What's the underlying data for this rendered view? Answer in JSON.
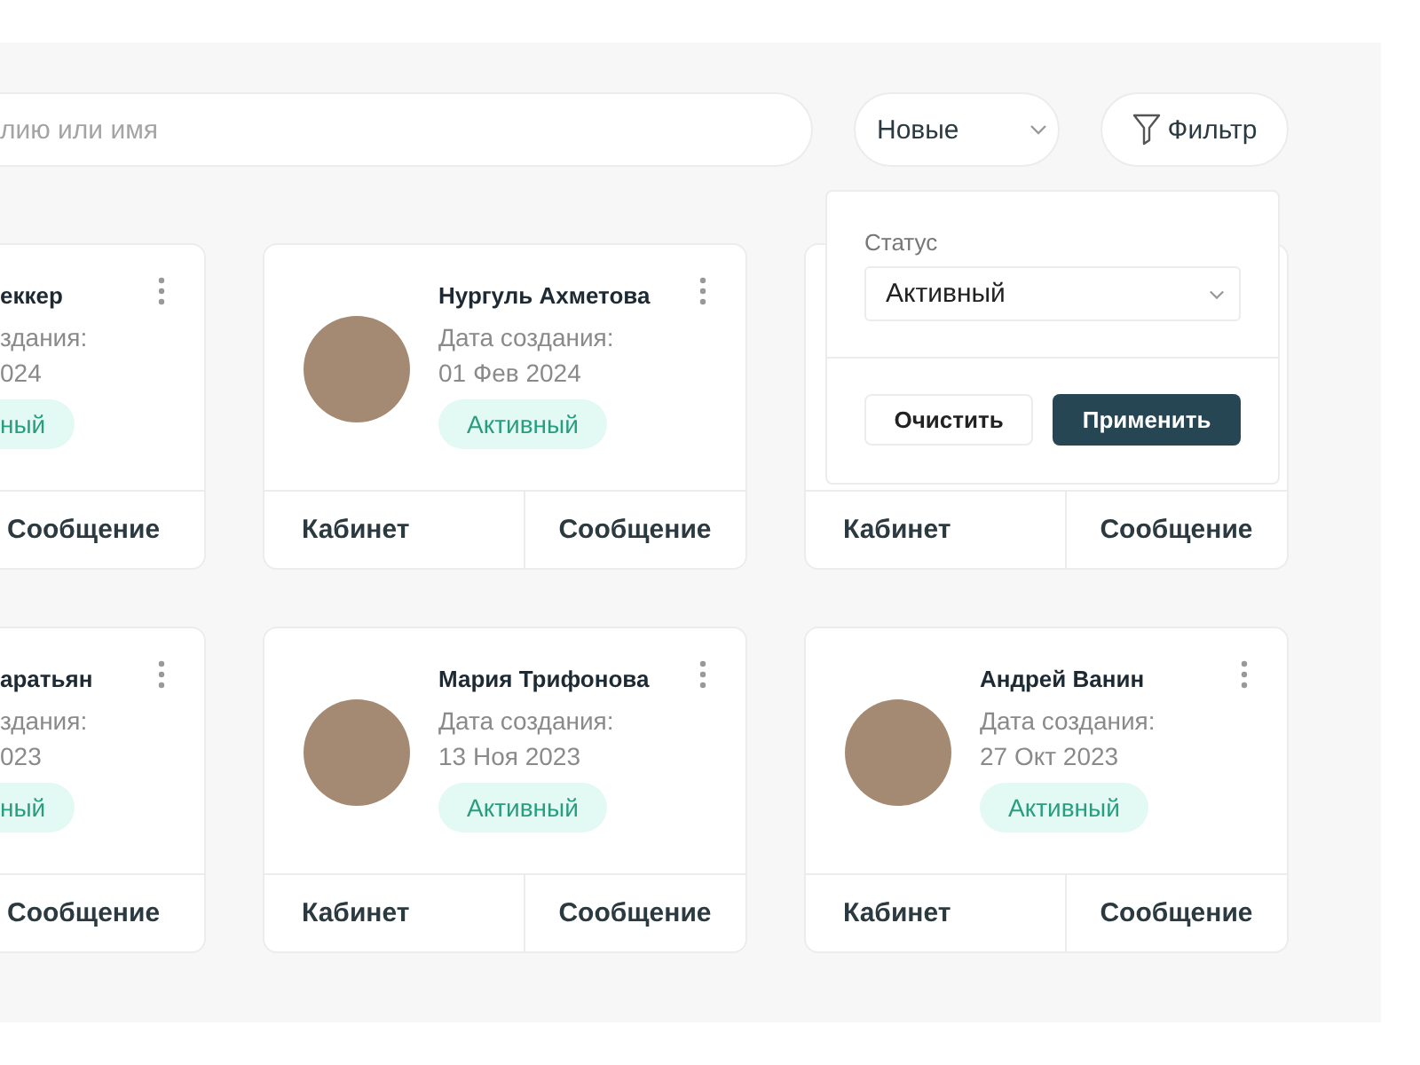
{
  "toolbar": {
    "search": {
      "placeholder": "лию или имя"
    },
    "sort": {
      "value": "Новые"
    },
    "filter_button": "Фильтр"
  },
  "filter_panel": {
    "label": "Статус",
    "status_value": "Активный",
    "buttons": [
      {
        "label": "Очистить",
        "kind": "secondary"
      },
      {
        "label": "Применить",
        "kind": "primary"
      }
    ]
  },
  "cards": [
    {
      "kind": "partial",
      "name": "еккер",
      "date_label": "здания:",
      "date": "024",
      "status": "ный",
      "buttons": [
        "Сообщение"
      ]
    },
    {
      "kind": "full",
      "name": "Нургуль  Ахметова",
      "date_label": "Дата создания:",
      "date": "01 Фев 2024",
      "status": "Активный",
      "buttons": [
        "Кабинет",
        "Сообщение"
      ]
    },
    {
      "kind": "covered",
      "buttons": [
        "Кабинет",
        "Сообщение"
      ]
    },
    {
      "kind": "partial",
      "name": "аратьян",
      "date_label": "здания:",
      "date": "023",
      "status": "ный",
      "buttons": [
        "Сообщение"
      ]
    },
    {
      "kind": "full",
      "name": "Мария  Трифонова",
      "date_label": "Дата создания:",
      "date": "13 Ноя 2023",
      "status": "Активный",
      "buttons": [
        "Кабинет",
        "Сообщение"
      ]
    },
    {
      "kind": "full",
      "name": "Андрей  Ванин",
      "date_label": "Дата создания:",
      "date": "27 Окт 2023",
      "status": "Активный",
      "buttons": [
        "Кабинет",
        "Сообщение"
      ]
    }
  ]
}
